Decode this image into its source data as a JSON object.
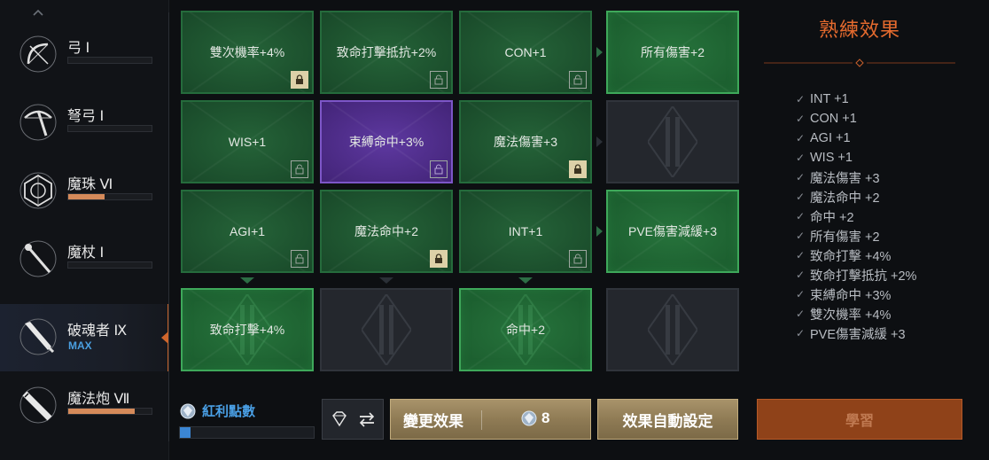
{
  "sidebar": {
    "weapons": [
      {
        "name": "弓 Ⅰ",
        "icon": "bow-icon",
        "progress": 0
      },
      {
        "name": "弩弓 Ⅰ",
        "icon": "crossbow-icon",
        "progress": 0
      },
      {
        "name": "魔珠 Ⅵ",
        "icon": "orb-icon",
        "progress": 0.44
      },
      {
        "name": "魔杖 Ⅰ",
        "icon": "wand-icon",
        "progress": 0
      },
      {
        "name": "破魂者 Ⅸ",
        "icon": "soulbreaker-icon",
        "badge": "MAX",
        "active": true
      },
      {
        "name": "魔法炮 Ⅶ",
        "icon": "cannon-icon",
        "progress": 0.8
      }
    ]
  },
  "grid": {
    "rows": [
      [
        {
          "label": "雙次機率+4%",
          "style": "green",
          "lock": "filled"
        },
        {
          "label": "致命打擊抵抗+2%",
          "style": "green",
          "lock": "outline"
        },
        {
          "label": "CON+1",
          "style": "green",
          "lock": "outline"
        },
        {
          "label": "所有傷害+2",
          "style": "bright"
        }
      ],
      [
        {
          "label": "WIS+1",
          "style": "green",
          "lock": "outline"
        },
        {
          "label": "束縛命中+3%",
          "style": "purple",
          "lock": "outline"
        },
        {
          "label": "魔法傷害+3",
          "style": "green",
          "lock": "filled"
        },
        {
          "label": "",
          "style": "dark"
        }
      ],
      [
        {
          "label": "AGI+1",
          "style": "green",
          "lock": "outline"
        },
        {
          "label": "魔法命中+2",
          "style": "green",
          "lock": "filled"
        },
        {
          "label": "INT+1",
          "style": "green",
          "lock": "outline"
        },
        {
          "label": "PVE傷害減緩+3",
          "style": "bright"
        }
      ],
      [
        {
          "label": "致命打擊+4%",
          "style": "bright"
        },
        {
          "label": "",
          "style": "dark"
        },
        {
          "label": "命中+2",
          "style": "bright"
        },
        {
          "label": "",
          "style": "dark"
        }
      ]
    ]
  },
  "effects": {
    "title": "熟練效果",
    "items": [
      "INT +1",
      "CON +1",
      "AGI +1",
      "WIS +1",
      "魔法傷害 +3",
      "魔法命中 +2",
      "命中 +2",
      "所有傷害 +2",
      "致命打擊 +4%",
      "致命打擊抵抗 +2%",
      "束縛命中 +3%",
      "雙次機率 +4%",
      "PVE傷害減緩 +3"
    ]
  },
  "bottom": {
    "points_label": "紅利點數",
    "points_progress": 0.08,
    "change_label": "變更效果",
    "change_cost": "8",
    "auto_label": "效果自動設定",
    "learn_label": "學習"
  },
  "colors": {
    "accent_orange": "#e46a2e",
    "max_blue": "#4a9fe0",
    "cell_green": "#1d5530",
    "cell_purple": "#4e2a8c",
    "button_gold": "#a8936a"
  }
}
